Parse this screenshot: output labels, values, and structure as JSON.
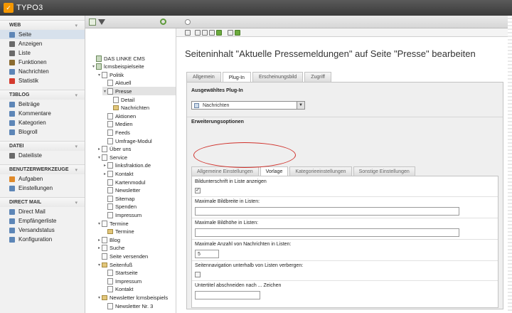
{
  "app": {
    "logo_text": "TYPO3"
  },
  "modmenu": {
    "groups": [
      {
        "title": "WEB",
        "items": [
          {
            "label": "Seite",
            "icon": "page-icon",
            "color": "#5d86b7"
          },
          {
            "label": "Anzeigen",
            "icon": "view-icon",
            "color": "#6a6a6a"
          },
          {
            "label": "Liste",
            "icon": "list-icon",
            "color": "#6a6a6a"
          },
          {
            "label": "Funktionen",
            "icon": "wand-icon",
            "color": "#8a6a2e"
          },
          {
            "label": "Nachrichten",
            "icon": "news-icon",
            "color": "#5d86b7"
          },
          {
            "label": "Statistik",
            "icon": "statistics-icon",
            "color": "#d43a2e"
          }
        ]
      },
      {
        "title": "T3BLOG",
        "items": [
          {
            "label": "Beiträge",
            "icon": "post-icon",
            "color": "#5d86b7"
          },
          {
            "label": "Kommentare",
            "icon": "comment-icon",
            "color": "#5d86b7"
          },
          {
            "label": "Kategorien",
            "icon": "category-icon",
            "color": "#5d86b7"
          },
          {
            "label": "Blogroll",
            "icon": "blogroll-icon",
            "color": "#5d86b7"
          }
        ]
      },
      {
        "title": "DATEI",
        "items": [
          {
            "label": "Dateiliste",
            "icon": "file-list-icon",
            "color": "#6a6a6a"
          }
        ]
      },
      {
        "title": "BENUTZERWERKZEUGE",
        "items": [
          {
            "label": "Aufgaben",
            "icon": "tasks-icon",
            "color": "#e08a2a"
          },
          {
            "label": "Einstellungen",
            "icon": "settings-icon",
            "color": "#5d86b7"
          }
        ]
      },
      {
        "title": "DIRECT MAIL",
        "items": [
          {
            "label": "Direct Mail",
            "icon": "mail-icon",
            "color": "#5d86b7"
          },
          {
            "label": "Empfängerliste",
            "icon": "recipients-icon",
            "color": "#5d86b7"
          },
          {
            "label": "Versandstatus",
            "icon": "status-icon",
            "color": "#5d86b7"
          },
          {
            "label": "Konfiguration",
            "icon": "config-icon",
            "color": "#5d86b7"
          }
        ]
      }
    ]
  },
  "tree": {
    "nodes": [
      {
        "label": "DAS LINKE CMS",
        "level": 0,
        "pm": "",
        "type": "root"
      },
      {
        "label": "lcmsbeispielseite",
        "level": 0,
        "pm": "▾",
        "type": "root"
      },
      {
        "label": "Politik",
        "level": 1,
        "pm": "▾",
        "type": "page"
      },
      {
        "label": "Aktuell",
        "level": 2,
        "pm": "",
        "type": "page"
      },
      {
        "label": "Presse",
        "level": 2,
        "pm": "▾",
        "type": "page"
      },
      {
        "label": "Detail",
        "level": 3,
        "pm": "",
        "type": "page"
      },
      {
        "label": "Nachrichten",
        "level": 3,
        "pm": "",
        "type": "folder"
      },
      {
        "label": "Aktionen",
        "level": 2,
        "pm": "",
        "type": "page"
      },
      {
        "label": "Medien",
        "level": 2,
        "pm": "",
        "type": "page"
      },
      {
        "label": "Feeds",
        "level": 2,
        "pm": "",
        "type": "page"
      },
      {
        "label": "Umfrage-Modul",
        "level": 2,
        "pm": "",
        "type": "page"
      },
      {
        "label": "Über uns",
        "level": 1,
        "pm": "▸",
        "type": "page"
      },
      {
        "label": "Service",
        "level": 1,
        "pm": "▾",
        "type": "page"
      },
      {
        "label": "linksfraktion.de",
        "level": 2,
        "pm": "▸",
        "type": "page"
      },
      {
        "label": "Kontakt",
        "level": 2,
        "pm": "▸",
        "type": "page"
      },
      {
        "label": "Kartenmodul",
        "level": 2,
        "pm": "",
        "type": "page"
      },
      {
        "label": "Newsletter",
        "level": 2,
        "pm": "",
        "type": "page"
      },
      {
        "label": "Sitemap",
        "level": 2,
        "pm": "",
        "type": "page"
      },
      {
        "label": "Spenden",
        "level": 2,
        "pm": "",
        "type": "page"
      },
      {
        "label": "Impressum",
        "level": 2,
        "pm": "",
        "type": "page"
      },
      {
        "label": "Termine",
        "level": 1,
        "pm": "▾",
        "type": "page"
      },
      {
        "label": "Termine",
        "level": 2,
        "pm": "",
        "type": "folder"
      },
      {
        "label": "Blog",
        "level": 1,
        "pm": "▸",
        "type": "page"
      },
      {
        "label": "Suche",
        "level": 1,
        "pm": "▸",
        "type": "page"
      },
      {
        "label": "Seite versenden",
        "level": 1,
        "pm": "",
        "type": "page"
      },
      {
        "label": "Seitenfuß",
        "level": 1,
        "pm": "▾",
        "type": "folder"
      },
      {
        "label": "Startseite",
        "level": 2,
        "pm": "",
        "type": "page"
      },
      {
        "label": "Impressum",
        "level": 2,
        "pm": "",
        "type": "page"
      },
      {
        "label": "Kontakt",
        "level": 2,
        "pm": "",
        "type": "page"
      },
      {
        "label": "Newsletter lcmsbeispiels",
        "level": 1,
        "pm": "▾",
        "type": "folder"
      },
      {
        "label": "Newsletter Nr. 3",
        "level": 2,
        "pm": "",
        "type": "page"
      }
    ]
  },
  "content": {
    "title": "Seiteninhalt \"Aktuelle Pressemeldungen\" auf Seite \"Presse\" bearbeiten",
    "tabs": [
      "Allgemein",
      "Plug-In",
      "Erscheinungsbild",
      "Zugriff"
    ],
    "active_tab": 1,
    "plugin_section": "Ausgewähltes Plug-In",
    "plugin_value": "Nachrichten",
    "ext_section": "Erweiterungsoptionen",
    "subtabs": [
      "Allgemeine Einstellungen",
      "Vorlage",
      "Kategorieeinstellungen",
      "Sonstige Einstellungen"
    ],
    "active_subtab": 1,
    "fields": {
      "caption_label": "Bildunterschrift in Liste anzeigen",
      "caption_checked": "✓",
      "maxwidth_label": "Maximale Bildbreite in Listen:",
      "maxwidth_value": "",
      "maxheight_label": "Maximale Bildhöhe in Listen:",
      "maxheight_value": "",
      "maxcount_label": "Maximale Anzahl von Nachrichten in Listen:",
      "maxcount_value": "5",
      "hidenav_label": "Seitennavigation unterhalb von Listen verbergen:",
      "hidenav_checked": "",
      "subtitle_label": "Untertitel abschneiden nach ... Zeichen",
      "subtitle_value": ""
    }
  }
}
